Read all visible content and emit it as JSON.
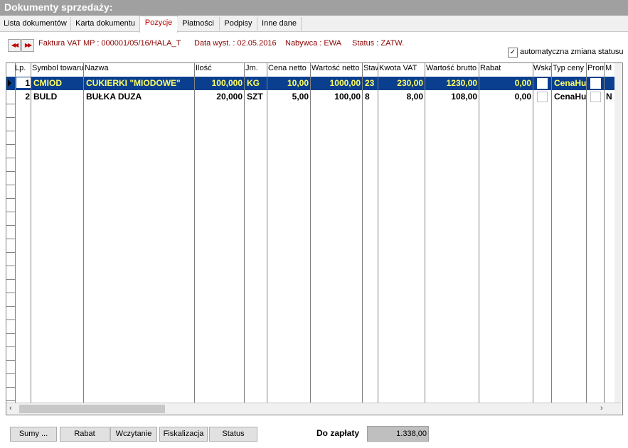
{
  "window": {
    "title": "Dokumenty sprzedaży:"
  },
  "tabs": [
    {
      "label": "Lista dokumentów"
    },
    {
      "label": "Karta dokumentu"
    },
    {
      "label": "Pozycje"
    },
    {
      "label": "Płatności"
    },
    {
      "label": "Podpisy"
    },
    {
      "label": "Inne dane"
    }
  ],
  "active_tab": "Pozycje",
  "document": {
    "title": "Faktura VAT MP : 000001/05/16/HALA_T",
    "date": "Data wyst. : 02.05.2016",
    "buyer": "Nabywca : EWA",
    "status": "Status : ZATW."
  },
  "auto_status": {
    "label": "automatyczna zmiana statusu",
    "checked": true,
    "check_glyph": "✓"
  },
  "grid": {
    "columns": [
      "Lp.",
      "Symbol towaru",
      "Nazwa",
      "Ilość",
      "Jm.",
      "Cena netto",
      "Wartość netto",
      "Stawka",
      "Kwota VAT",
      "Wartość brutto",
      "Rabat",
      "Wskaźnik",
      "Typ ceny",
      "Promocja",
      "M"
    ],
    "rows": [
      {
        "lp": "1",
        "symbol": "CMIOD",
        "nazwa": "CUKIERKI \"MIODOWE\"",
        "ilosc": "100,000",
        "jm": "KG",
        "cena_netto": "10,00",
        "wartosc_netto": "1000,00",
        "stawka": "23",
        "kwota_vat": "230,00",
        "wartosc_brutto": "1230,00",
        "rabat": "0,00",
        "typ_ceny": "CenaHurt",
        "m": ""
      },
      {
        "lp": "2",
        "symbol": "BULD",
        "nazwa": "BUŁKA DUZA",
        "ilosc": "20,000",
        "jm": "SZT",
        "cena_netto": "5,00",
        "wartosc_netto": "100,00",
        "stawka": "8",
        "kwota_vat": "8,00",
        "wartosc_brutto": "108,00",
        "rabat": "0,00",
        "typ_ceny": "CenaHurt",
        "m": "N"
      }
    ],
    "selected_row": 1,
    "selection_color": "#0a3f8f",
    "selection_text_color": "#ffff66"
  },
  "buttons": [
    {
      "label": "Sumy ...",
      "underline": "S"
    },
    {
      "label": "Rabat",
      "underline": "R"
    },
    {
      "label": "Wczytanie",
      "underline": "W"
    },
    {
      "label": "Fiskalizacja",
      "underline": "F"
    },
    {
      "label": "Status",
      "underline": "S"
    }
  ],
  "footer": {
    "label": "Do zapłaty",
    "total": "1.338,00"
  },
  "icons": {
    "first": "double-left-arrow-icon",
    "prev": "double-right-arrow-icon",
    "row_pointer": "row-pointer-icon",
    "scroll_left": "scroll-left-icon",
    "scroll_right": "scroll-right-icon"
  }
}
